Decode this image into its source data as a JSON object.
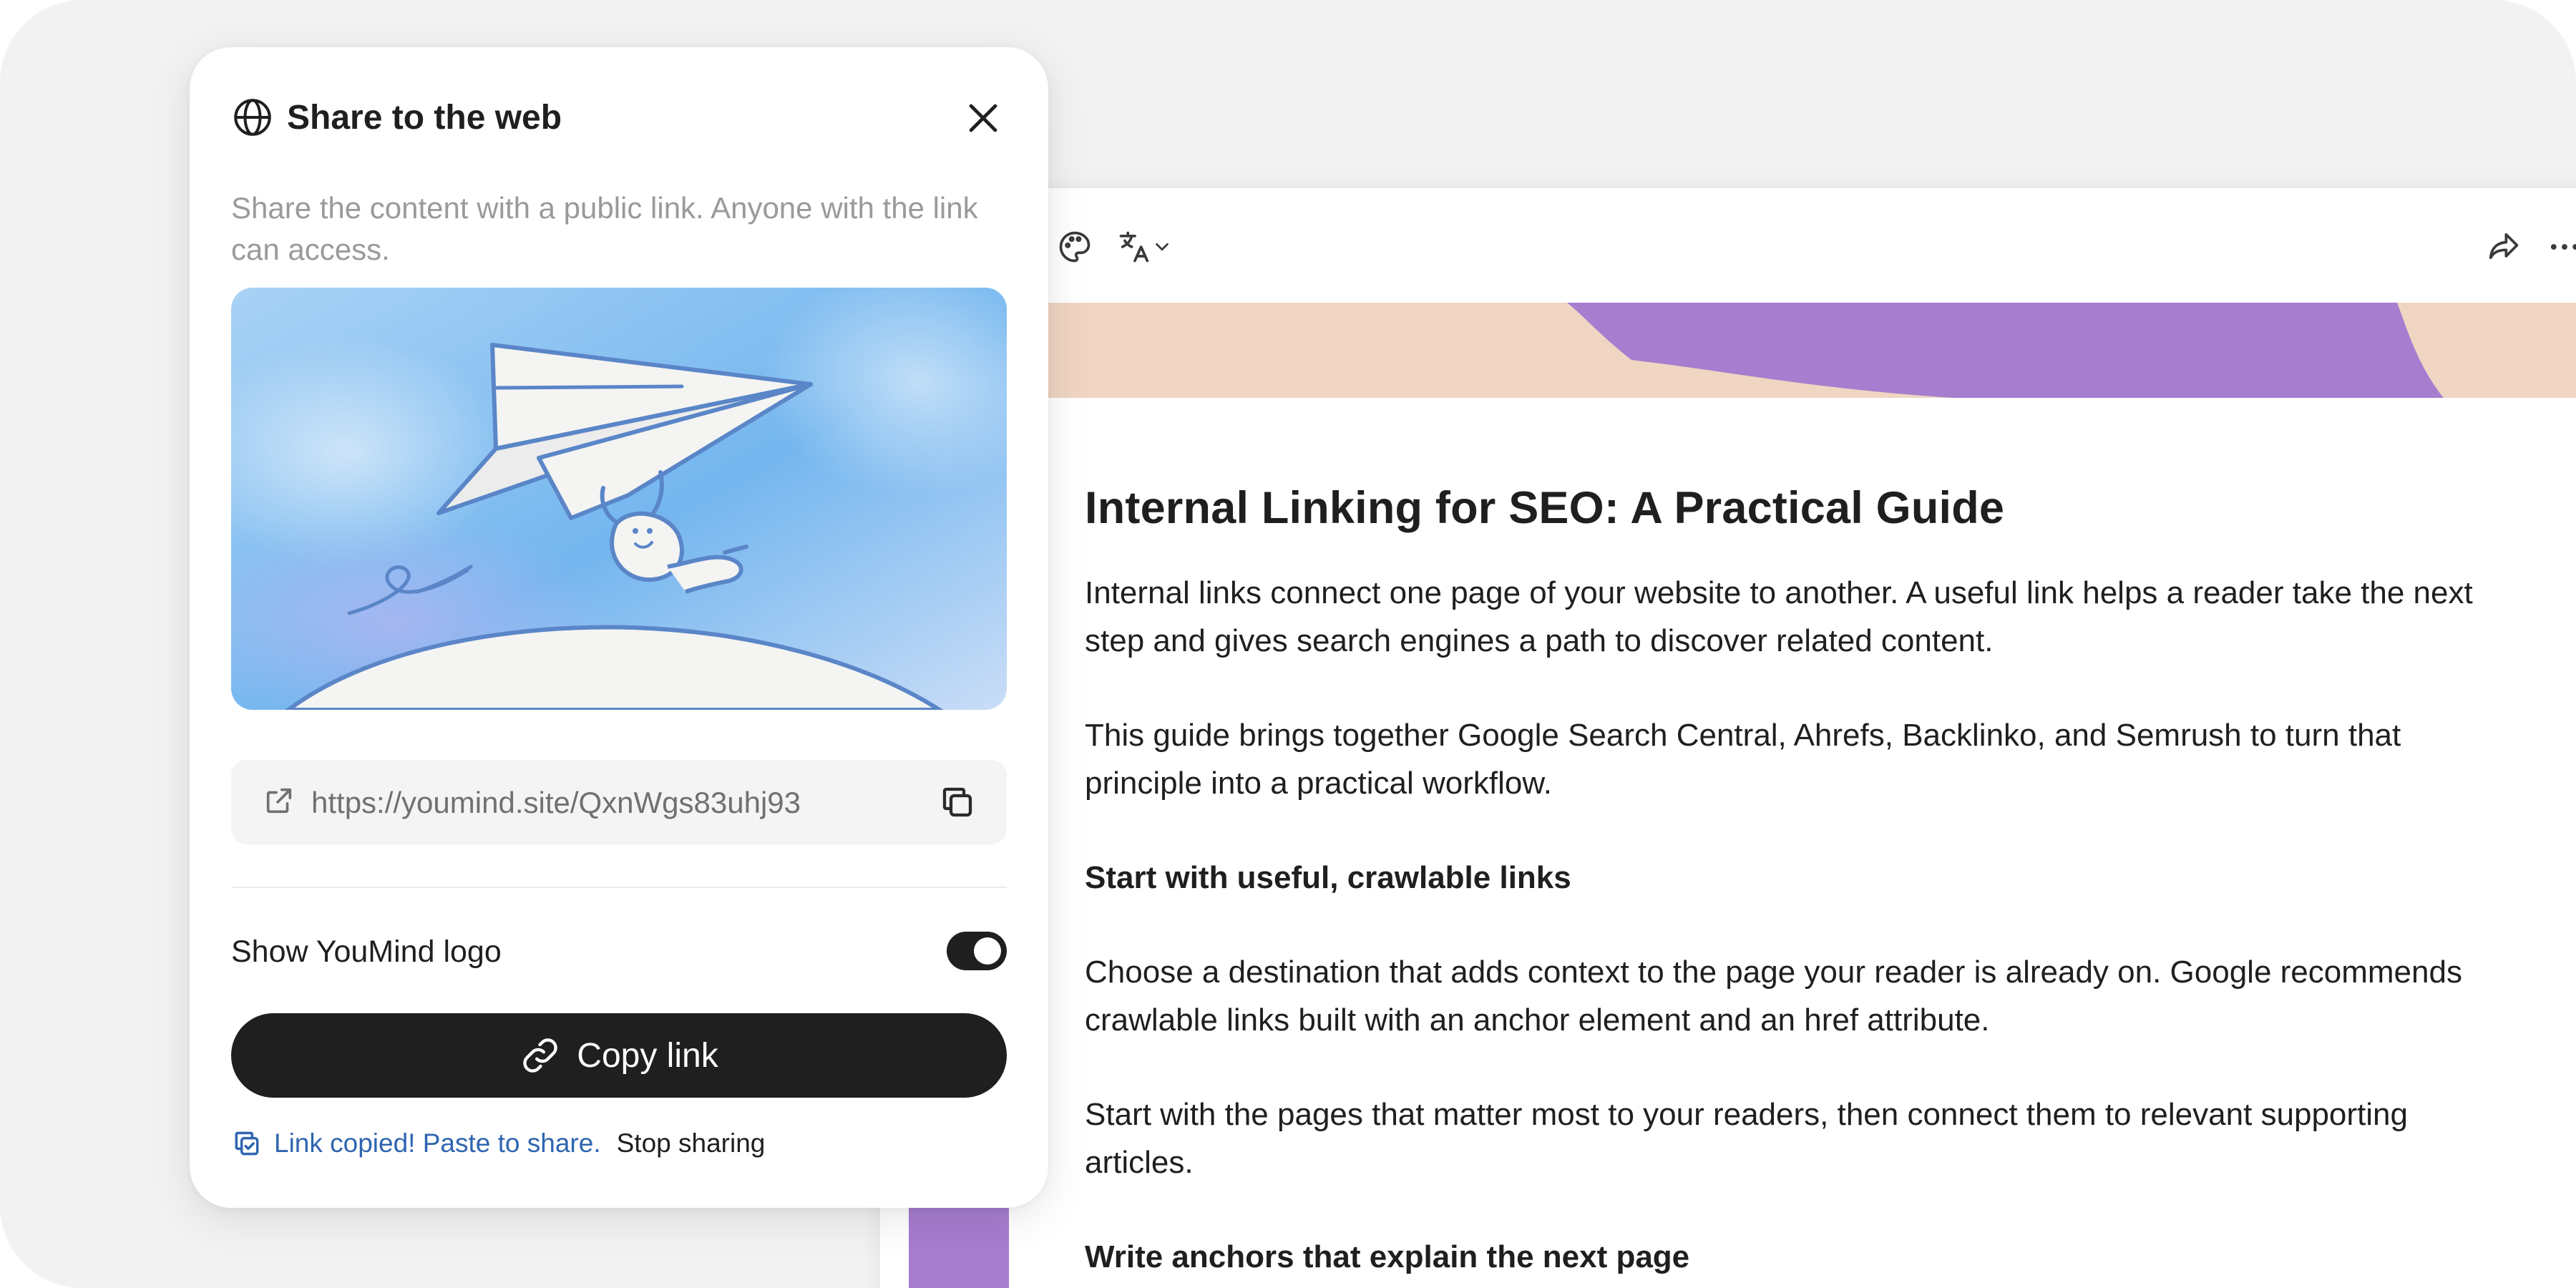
{
  "modal": {
    "title": "Share to the web",
    "description": "Share the content with a public link. Anyone with the link can access.",
    "url": "https://youmind.site/QxnWgs83uhj93",
    "logo_toggle_label": "Show YouMind logo",
    "logo_toggle_on": true,
    "copy_button_label": "Copy link",
    "copied_message": "Link copied! Paste to share.",
    "stop_sharing_label": "Stop sharing",
    "icons": {
      "header": "globe-icon",
      "close": "close-icon",
      "url": "external-link-icon",
      "copy": "copy-icon",
      "button": "link-icon",
      "status": "copied-check-icon"
    }
  },
  "document": {
    "toolbar_icons": [
      "palette-icon",
      "translate-icon",
      "chevron-down-icon",
      "share-icon",
      "more-icon"
    ],
    "title": "Internal Linking for SEO: A Practical Guide",
    "blocks": [
      {
        "type": "p",
        "text": "Internal links connect one page of your website to another. A useful link helps a reader take the next step and gives search engines a path to discover related content."
      },
      {
        "type": "p",
        "text": "This guide brings together Google Search Central, Ahrefs, Backlinko, and Semrush to turn that principle into a practical workflow."
      },
      {
        "type": "h",
        "text": "Start with useful, crawlable links"
      },
      {
        "type": "p",
        "text": "Choose a destination that adds context to the page your reader is already on. Google recommends crawlable links built with an anchor element and an href attribute."
      },
      {
        "type": "p",
        "text": "Start with the pages that matter most to your readers, then connect them to relevant supporting articles."
      },
      {
        "type": "h",
        "text": "Write anchors that explain the next page"
      }
    ]
  },
  "colors": {
    "canvas_bg": "#f2f2f2",
    "banner_peach": "#f0d5c2",
    "banner_purple": "#a67dcf",
    "button_dark": "#1f1f1f",
    "link_blue": "#2f65b0",
    "illustration_sky": "#74b6ef",
    "illustration_line": "#5a86c8"
  }
}
